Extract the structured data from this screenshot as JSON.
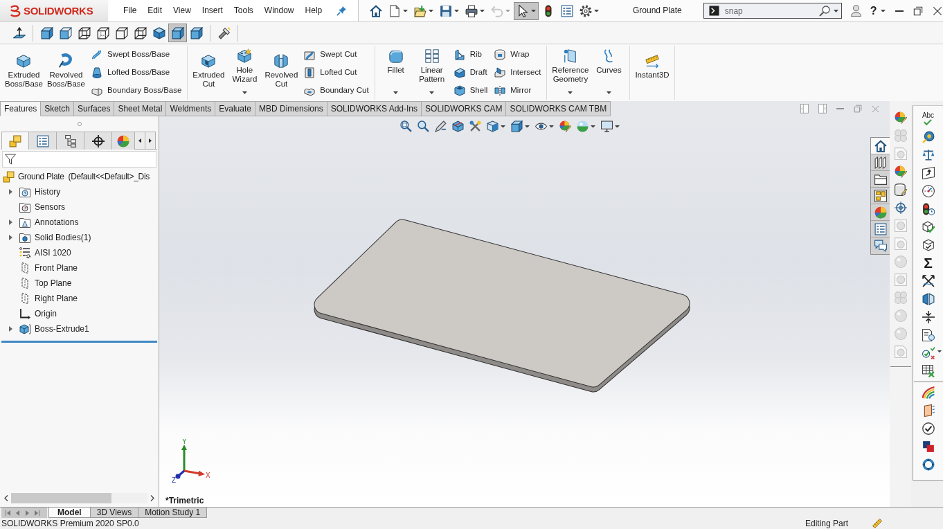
{
  "title_bar": {
    "logo_text": "SOLIDWORKS",
    "menu": [
      "File",
      "Edit",
      "View",
      "Insert",
      "Tools",
      "Window",
      "Help"
    ],
    "quick_access": [
      {
        "dropdown": false,
        "disabled": false,
        "selected": false
      },
      {
        "dropdown": true,
        "disabled": false,
        "selected": false
      },
      {
        "dropdown": true,
        "disabled": false,
        "selected": false
      },
      {
        "dropdown": true,
        "disabled": false,
        "selected": false
      },
      {
        "dropdown": true,
        "disabled": false,
        "selected": false
      },
      {
        "dropdown": true,
        "disabled": true,
        "selected": false
      },
      {
        "dropdown": true,
        "disabled": false,
        "selected": true
      },
      {
        "dropdown": false,
        "disabled": false,
        "selected": false
      },
      {
        "dropdown": false,
        "disabled": false,
        "selected": false
      },
      {
        "dropdown": true,
        "disabled": false,
        "selected": false
      }
    ],
    "document_title": "Ground Plate",
    "search": {
      "value": "snap"
    },
    "help": {
      "label": "?"
    }
  },
  "view_toolbar": [
    {
      "selected": false
    },
    {
      "selected": false
    },
    {
      "selected": false
    },
    {
      "selected": false
    },
    {
      "selected": false
    },
    {
      "selected": false
    },
    {
      "selected": false
    },
    {
      "selected": false
    },
    {
      "selected": true
    },
    {
      "selected": false
    },
    {
      "selected": false
    }
  ],
  "command_manager": {
    "groups": [
      {
        "large": [
          {
            "label": "Extruded Boss/Base",
            "dropdown": false
          },
          {
            "label": "Revolved Boss/Base",
            "dropdown": false
          }
        ],
        "small_columns": [
          [
            "Swept Boss/Base",
            "Lofted Boss/Base",
            "Boundary Boss/Base"
          ]
        ]
      },
      {
        "large": [
          {
            "label": "Extruded Cut",
            "dropdown": false
          },
          {
            "label": "Hole Wizard",
            "dropdown": true
          },
          {
            "label": "Revolved Cut",
            "dropdown": false
          }
        ],
        "small_columns": [
          [
            "Swept Cut",
            "Lofted Cut",
            "Boundary Cut"
          ]
        ]
      },
      {
        "large": [
          {
            "label": "Fillet",
            "dropdown": true
          },
          {
            "label": "Linear Pattern",
            "dropdown": true
          }
        ],
        "small_columns": [
          [
            "Rib",
            "Draft",
            "Shell"
          ],
          [
            "Wrap",
            "Intersect",
            "Mirror"
          ]
        ]
      },
      {
        "large": [
          {
            "label": "Reference Geometry",
            "dropdown": true
          },
          {
            "label": "Curves",
            "dropdown": true
          }
        ]
      },
      {
        "large": [
          {
            "label": "Instant3D",
            "dropdown": false
          }
        ]
      }
    ],
    "tabs": [
      {
        "label": "Features",
        "selected": true
      },
      {
        "label": "Sketch",
        "selected": false
      },
      {
        "label": "Surfaces",
        "selected": false
      },
      {
        "label": "Sheet Metal",
        "selected": false
      },
      {
        "label": "Weldments",
        "selected": false
      },
      {
        "label": "Evaluate",
        "selected": false
      },
      {
        "label": "MBD Dimensions",
        "selected": false
      },
      {
        "label": "SOLIDWORKS Add-Ins",
        "selected": false
      },
      {
        "label": "SOLIDWORKS CAM",
        "selected": false
      },
      {
        "label": "SOLIDWORKS CAM TBM",
        "selected": false
      }
    ]
  },
  "feature_manager": {
    "tabs": [
      {
        "selected": true
      },
      {
        "selected": false
      },
      {
        "selected": false
      },
      {
        "selected": false
      },
      {
        "selected": false
      }
    ],
    "tree": {
      "label": "Ground Plate  (Default<<Default>_Dis",
      "children": [
        {
          "label": "History",
          "kind": "history",
          "expanded": false
        },
        {
          "label": "Sensors",
          "kind": "sensors"
        },
        {
          "label": "Annotations",
          "kind": "annotations",
          "expanded": false
        },
        {
          "label": "Solid Bodies(1)",
          "kind": "bodies",
          "expanded": false
        },
        {
          "label": "AISI 1020",
          "kind": "material"
        },
        {
          "label": "Front Plane",
          "kind": "plane"
        },
        {
          "label": "Top Plane",
          "kind": "plane"
        },
        {
          "label": "Right Plane",
          "kind": "plane"
        },
        {
          "label": "Origin",
          "kind": "origin"
        },
        {
          "label": "Boss-Extrude1",
          "kind": "feature",
          "expanded": false
        }
      ]
    }
  },
  "viewport": {
    "view_name": "*Trimetric",
    "triad": {
      "x": "X",
      "y": "Y",
      "z": "Z"
    }
  },
  "task_pane": [
    {
      "selected": true
    },
    {
      "selected": false
    },
    {
      "selected": false
    },
    {
      "selected": false
    },
    {
      "selected": false
    },
    {
      "selected": false
    },
    {
      "selected": false
    }
  ],
  "right_toolbars": {
    "column_1": [
      {
        "disabled": false
      },
      {
        "disabled": true
      },
      {
        "disabled": true
      },
      {
        "disabled": false
      },
      {
        "disabled": false
      },
      {
        "disabled": false
      },
      {
        "disabled": true
      },
      {
        "disabled": true
      },
      {
        "disabled": true
      },
      {
        "disabled": true
      },
      {
        "disabled": true
      },
      {
        "disabled": true
      },
      {
        "disabled": true
      },
      {
        "disabled": true
      }
    ],
    "column_2": {
      "spell_check_text": "Abc",
      "sum_symbol": "Σ"
    }
  },
  "bottom_tabs": [
    {
      "label": "Model",
      "selected": true
    },
    {
      "label": "3D Views",
      "selected": false
    },
    {
      "label": "Motion Study 1",
      "selected": false
    }
  ],
  "status_bar": {
    "product": "SOLIDWORKS Premium 2020 SP0.0",
    "mode": "Editing Part"
  }
}
